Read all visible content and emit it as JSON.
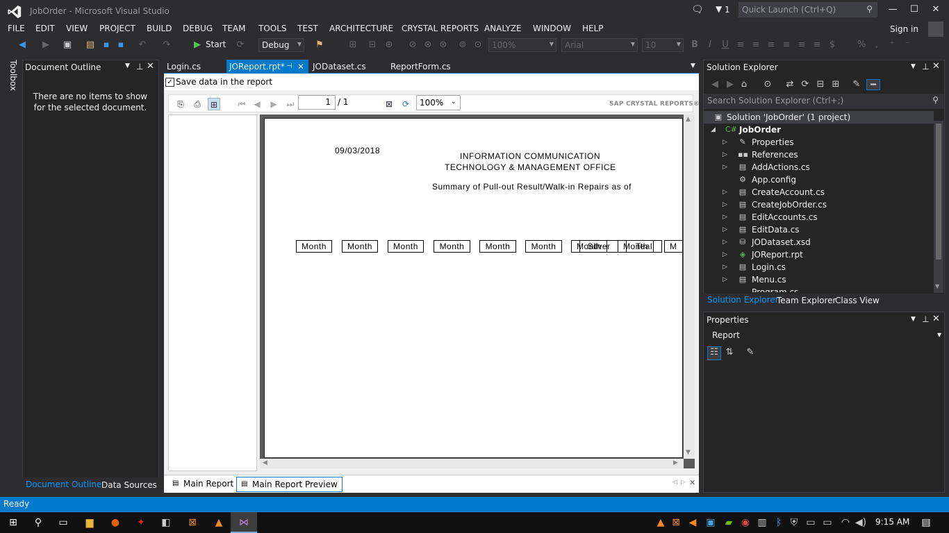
{
  "window": {
    "title": "JobOrder - Microsoft Visual Studio",
    "notifications_count": "1",
    "quick_launch_placeholder": "Quick Launch (Ctrl+Q)"
  },
  "menu": {
    "items": [
      "FILE",
      "EDIT",
      "VIEW",
      "PROJECT",
      "BUILD",
      "DEBUG",
      "TEAM",
      "TOOLS",
      "TEST",
      "ARCHITECTURE",
      "CRYSTAL REPORTS",
      "ANALYZE",
      "WINDOW",
      "HELP"
    ],
    "sign_in": "Sign in"
  },
  "toolbar": {
    "start_label": "Start",
    "config": "Debug",
    "zoom_disabled": "100%",
    "font_disabled": "Arial",
    "size_disabled": "10"
  },
  "toolbox": {
    "label": "Toolbox"
  },
  "document_outline": {
    "title": "Document Outline",
    "message": "There are no items to show for the selected document.",
    "tabs": [
      "Document Outline",
      "Data Sources"
    ]
  },
  "editor_tabs": [
    "Login.cs",
    "JOReport.rpt*",
    "JODataset.cs",
    "ReportForm.cs"
  ],
  "report_viewer": {
    "save_data_label": "Save data in the report",
    "page_current": "1",
    "page_total": "/ 1",
    "zoom": "100%",
    "brand": "SAP CRYSTAL REPORTS®",
    "bottom_tabs": [
      "Main Report",
      "Main Report Preview"
    ]
  },
  "report": {
    "date": "09/03/2018",
    "header_line1": "INFORMATION COMMUNICATION",
    "header_line2": "TECHNOLOGY & MANAGEMENT OFFICE",
    "subtitle": "Summary of Pull-out Result/Walk-in Repairs as of",
    "columns": [
      "Month",
      "Month",
      "Month",
      "Month",
      "Month",
      "Month",
      "Month",
      "Month",
      "M"
    ],
    "overlap_labels": [
      "Silver",
      "Teal"
    ]
  },
  "solution_explorer": {
    "title": "Solution Explorer",
    "search_placeholder": "Search Solution Explorer (Ctrl+;)",
    "solution": "Solution 'JobOrder' (1 project)",
    "project": "JobOrder",
    "items": [
      "Properties",
      "References",
      "AddActions.cs",
      "App.config",
      "CreateAccount.cs",
      "CreateJobOrder.cs",
      "EditAccounts.cs",
      "EditData.cs",
      "JODataset.xsd",
      "JOReport.rpt",
      "Login.cs",
      "Menu.cs",
      "Program.cs"
    ],
    "tabs": [
      "Solution Explorer",
      "Team Explorer",
      "Class View"
    ]
  },
  "properties": {
    "title": "Properties",
    "object": "Report"
  },
  "statusbar": {
    "text": "Ready"
  },
  "taskbar": {
    "time": "9:15 AM"
  },
  "colors": {
    "accent": "#007acc",
    "bg": "#2d2d30",
    "panel": "#252526"
  }
}
